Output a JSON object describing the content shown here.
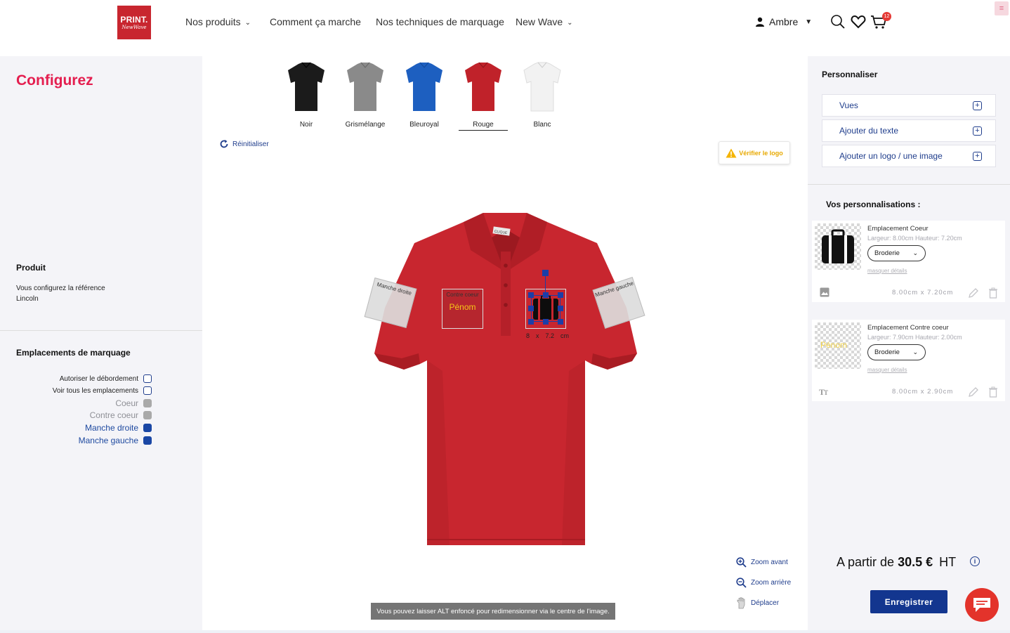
{
  "header": {
    "logo_line1": "PRINT.",
    "logo_line2": "NewWave",
    "nav": [
      {
        "label": "Nos produits",
        "has_dropdown": true
      },
      {
        "label": "Comment ça marche",
        "has_dropdown": false
      },
      {
        "label": "Nos techniques de marquage",
        "has_dropdown": false
      },
      {
        "label": "New Wave",
        "has_dropdown": true
      }
    ],
    "user_name": "Ambre",
    "cart_count": "12",
    "icons": [
      "user-icon",
      "search-icon",
      "heart-icon",
      "cart-icon",
      "menu-icon"
    ]
  },
  "left": {
    "title": "Configurez",
    "product_title": "Produit",
    "product_desc_line1": "Vous configurez la référence",
    "product_desc_line2": "Lincoln",
    "emplacements_title": "Emplacements de marquage",
    "options": [
      {
        "label": "Autoriser le débordement",
        "state": "unchecked"
      },
      {
        "label": "Voir tous les emplacements",
        "state": "unchecked"
      },
      {
        "label": "Coeur",
        "state": "grey"
      },
      {
        "label": "Contre coeur",
        "state": "grey"
      },
      {
        "label": "Manche droite",
        "state": "blue"
      },
      {
        "label": "Manche gauche",
        "state": "blue"
      }
    ]
  },
  "center": {
    "colors": [
      {
        "label": "Noir",
        "color": "#1b1b1b"
      },
      {
        "label": "Grismélange",
        "color": "#8a8a8a"
      },
      {
        "label": "Bleuroyal",
        "color": "#1d5fc0"
      },
      {
        "label": "Rouge",
        "color": "#c0222a",
        "active": true
      },
      {
        "label": "Blanc",
        "color": "#f2f2f2"
      }
    ],
    "reset_label": "Réinitialiser",
    "verify_label": "Vérifier le logo",
    "zones": {
      "manche_droite": "Manche droite",
      "contre_coeur": "Contre coeur",
      "contre_coeur_text": "Pénom",
      "manche_gauche": "Manche gauche",
      "dim_w": "8",
      "dim_x": "x",
      "dim_h": "7.2",
      "dim_unit": "cm",
      "collar_label": "CLIQUE"
    },
    "zoom_in": "Zoom avant",
    "zoom_out": "Zoom arrière",
    "move": "Déplacer",
    "tooltip": "Vous pouvez laisser ALT enfoncé pour redimensionner via le centre de l'image.",
    "shirt_color": "#c8262f"
  },
  "right": {
    "title": "Personnaliser",
    "accordions": [
      "Vues",
      "Ajouter du texte",
      "Ajouter un logo / une image"
    ],
    "vos_title": "Vos personnalisations :",
    "cards": [
      {
        "title": "Emplacement Coeur",
        "dims": "Largeur: 8.00cm Hauteur: 7.20cm",
        "technique": "Broderie",
        "hide": "masquer détails",
        "size": "8.00cm x 7.20cm",
        "type_icon": "image-icon"
      },
      {
        "title": "Emplacement Contre coeur",
        "dims": "Largeur: 7.90cm Hauteur: 2.00cm",
        "technique": "Broderie",
        "hide": "masquer détails",
        "size": "8.00cm x 2.90cm",
        "type_icon": "text-icon",
        "thumb_text": "Pénom"
      }
    ],
    "price_prefix": "A partir de",
    "price_value": "30.5 €",
    "price_suffix": "HT",
    "save_label": "Enregistrer"
  }
}
